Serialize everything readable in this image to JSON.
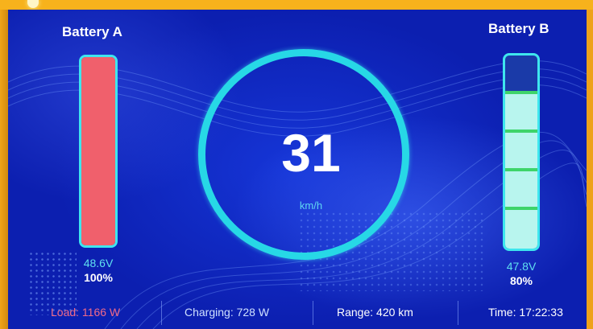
{
  "battery_a": {
    "title": "Battery A",
    "voltage": "48.6V",
    "percent": "100%",
    "level": 1.0,
    "color": "#f0606c"
  },
  "battery_b": {
    "title": "Battery B",
    "voltage": "47.8V",
    "percent": "80%",
    "level": 0.8,
    "color": "#b8f5ee",
    "segment_color": "#3ed46a"
  },
  "speed": {
    "value": "31",
    "unit": "km/h"
  },
  "status_bar": {
    "load": "Load: 1166 W",
    "charging": "Charging: 728 W",
    "range": "Range: 420 km",
    "time": "Time: 17:22:33"
  },
  "colors": {
    "accent": "#27d8e6",
    "background": "#1230c8",
    "load_text": "#f06a88",
    "frame": "#f2a81a"
  }
}
